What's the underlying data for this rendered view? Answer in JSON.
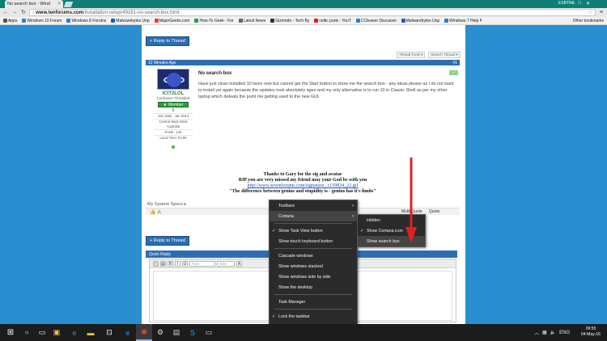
{
  "browser": {
    "tab_title": "No search box - Wind",
    "tab_close": "×",
    "user_name": "ESBTRS",
    "window_buttons": [
      "–",
      "□",
      "✕"
    ],
    "address": {
      "host": "www.tenforums.com",
      "path": "/installation-setup/49181-no-search-box.html"
    },
    "bookmarks": [
      {
        "label": "Apps",
        "color": "#555555"
      },
      {
        "label": "Windows 10 Forum",
        "color": "#2a7fd6"
      },
      {
        "label": "Windows 8 Forums",
        "color": "#2a7fd6"
      },
      {
        "label": "Malwarebytes Unp",
        "color": "#1e5fb8"
      },
      {
        "label": "MajorGeeks.com",
        "color": "#d64b2a"
      },
      {
        "label": "How-To Geek - For",
        "color": "#2a9d4b"
      },
      {
        "label": "Latest News",
        "color": "#666666"
      },
      {
        "label": "Gizmodo - Tech By",
        "color": "#333333"
      },
      {
        "label": "celtic punk - YouT",
        "color": "#e02020"
      },
      {
        "label": "CCleaner Discussio",
        "color": "#2e7fc9"
      },
      {
        "label": "Malwarebytes Unp",
        "color": "#1e5fb8"
      },
      {
        "label": "Windows 7 Help F",
        "color": "#2a7fd6"
      }
    ],
    "other_bookmarks": "Other bookmarks"
  },
  "page": {
    "breadcrumb": "› Windows 10 Forums › Installation and Setup › No search box",
    "reply_button": "+ Reply to Thread",
    "thread_tools": "Thread Tools ▾",
    "search_thread": "Search Thread ▾",
    "post": {
      "time": "12 Minutes Ago",
      "number": "#1",
      "title": "No search box",
      "quote_icon": "✓",
      "text": "Have just clean installed 10 twice now but cannot get the Start button to show me the search box - any ideas please as I do not want to install yet again because the updates took absolutely ages and my only alternative is to run 10 in Classic Shell as per my other laptop which defeats the point me getting used to the new GUI.",
      "user": {
        "name": "ICIT2LOL",
        "title": "Confusion Threaded",
        "rank": "Member",
        "rep": "0",
        "join_date": "Join Date : Jan 2014",
        "location": "Central West NSW Australia",
        "posts": "Posts : 133",
        "local_time": "Local Time: 01:55"
      }
    },
    "signature": {
      "line1": "Thanks to Gary for the sig and avatar",
      "line2": "RIP you are very missed my friend may your God be with you",
      "line3": "http://www.sevenforums.com/signature...c159834_22.gif",
      "line4": "\"The difference between genius and stupidity is - genius has it's limits\""
    },
    "system_specs": "My System Specs ▸",
    "footer_actions": [
      "Multi-Quote",
      "Quote"
    ],
    "quick_reply": "Quick Reply",
    "editor": {
      "font_placeholder": "Font",
      "size_placeholder": "Size",
      "buttons": [
        "B",
        "I",
        "U",
        "A"
      ]
    }
  },
  "context_menu": {
    "items": [
      {
        "label": "Toolbars",
        "arrow": "›",
        "check": ""
      },
      {
        "label": "Cortana",
        "arrow": "›",
        "check": ""
      },
      {
        "label": "Show Task View button",
        "arrow": "",
        "check": "✓"
      },
      {
        "label": "Show touch keyboard button",
        "arrow": "",
        "check": ""
      },
      {
        "label": "Cascade windows",
        "arrow": "",
        "check": ""
      },
      {
        "label": "Show windows stacked",
        "arrow": "",
        "check": ""
      },
      {
        "label": "Show windows side by side",
        "arrow": "",
        "check": ""
      },
      {
        "label": "Show the desktop",
        "arrow": "",
        "check": ""
      },
      {
        "label": "Task Manager",
        "arrow": "",
        "check": ""
      },
      {
        "label": "Lock the taskbar",
        "arrow": "",
        "check": "✓"
      },
      {
        "label": "Properties",
        "arrow": "",
        "check": ""
      }
    ],
    "submenu": [
      {
        "label": "Hidden",
        "check": ""
      },
      {
        "label": "Show Cortana icon",
        "check": "✓"
      },
      {
        "label": "Show search box",
        "check": ""
      }
    ]
  },
  "taskbar": {
    "clock_time": "09:55",
    "clock_date": "04-May-16",
    "tray": [
      "ENG"
    ]
  },
  "colors": {
    "taskbar": "#1c1c1c",
    "accent_blue": "#2c6eb4",
    "arrow_red": "#e02020"
  }
}
